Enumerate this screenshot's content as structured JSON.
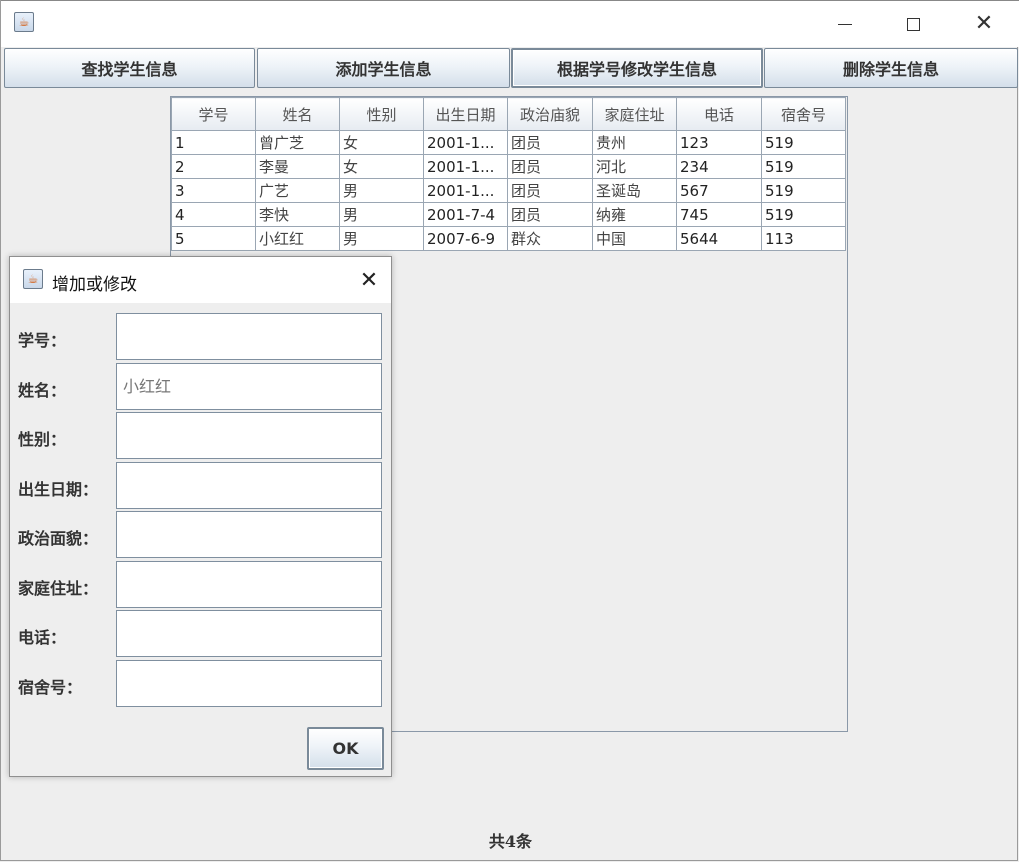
{
  "window": {
    "title": "",
    "icon": "java-icon",
    "controls": [
      "minimize-icon",
      "maximize-icon",
      "close-icon"
    ]
  },
  "toolbar": {
    "find_label": "查找学生信息",
    "add_label": "添加学生信息",
    "modify_label": "根据学号修改学生信息",
    "delete_label": "删除学生信息"
  },
  "table": {
    "columns": [
      "学号",
      "姓名",
      "性别",
      "出生日期",
      "政治庙貌",
      "家庭住址",
      "电话",
      "宿舍号"
    ],
    "rows": [
      [
        "1",
        "曾广芝",
        "女",
        "2001-1...",
        "团员",
        "贵州",
        "123",
        "519"
      ],
      [
        "2",
        "李曼",
        "女",
        "2001-1...",
        "团员",
        "河北",
        "234",
        "519"
      ],
      [
        "3",
        "广艺",
        "男",
        "2001-1...",
        "团员",
        "圣诞岛",
        "567",
        "519"
      ],
      [
        "4",
        "李快",
        "男",
        "2001-7-4",
        "团员",
        "纳雍",
        "745",
        "519"
      ],
      [
        "5",
        "小红红",
        "男",
        "2007-6-9",
        "群众",
        "中国",
        "5644",
        "113"
      ]
    ]
  },
  "footer": {
    "count_text": "共4条"
  },
  "dialog": {
    "title": "增加或修改",
    "fields": [
      {
        "label": "学号：",
        "value": ""
      },
      {
        "label": "姓名：",
        "value": "",
        "placeholder": "小红红"
      },
      {
        "label": "性别：",
        "value": ""
      },
      {
        "label": "出生日期：",
        "value": ""
      },
      {
        "label": "政治面貌：",
        "value": ""
      },
      {
        "label": "家庭住址：",
        "value": ""
      },
      {
        "label": "电话：",
        "value": ""
      },
      {
        "label": "宿舍号：",
        "value": ""
      }
    ],
    "ok_label": "OK"
  }
}
